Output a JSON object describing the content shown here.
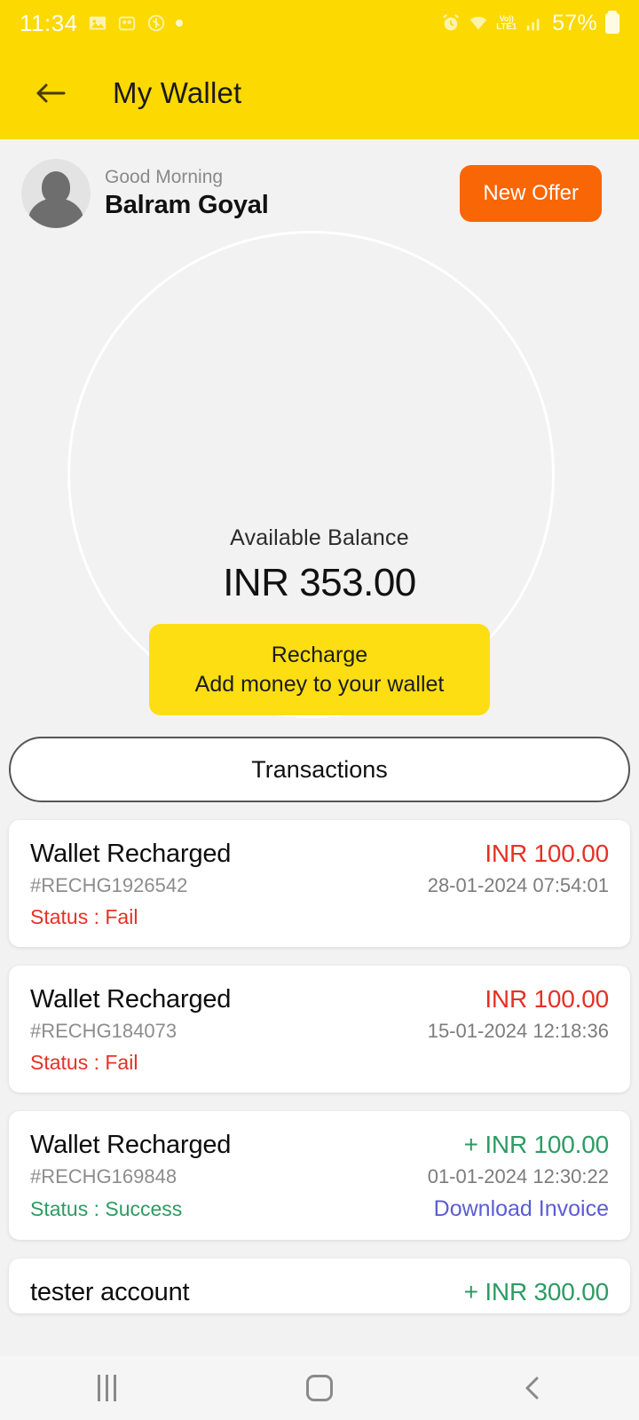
{
  "status_bar": {
    "time": "11:34",
    "battery_percent": "57%",
    "network_label_top": "Vo))",
    "network_label_bottom": "LTE1",
    "icons": [
      "image-icon",
      "app-icon",
      "app-icon-2",
      "dot-indicator",
      "alarm-icon",
      "wifi-icon",
      "volte-icon",
      "signal-icon",
      "battery-icon"
    ]
  },
  "header": {
    "title": "My Wallet",
    "back_icon": "arrow-left-icon"
  },
  "profile": {
    "greeting": "Good Morning",
    "name": "Balram Goyal",
    "offer_button": "New Offer"
  },
  "balance": {
    "label": "Available Balance",
    "amount": "INR 353.00",
    "recharge_line1": "Recharge",
    "recharge_line2": "Add money to your wallet"
  },
  "transactions_tab": {
    "label": "Transactions"
  },
  "transactions": [
    {
      "title": "Wallet Recharged",
      "reference": "#RECHG1926542",
      "status": "Status : Fail",
      "status_type": "fail",
      "amount": "INR 100.00",
      "amount_type": "fail",
      "datetime": "28-01-2024 07:54:01",
      "invoice": ""
    },
    {
      "title": "Wallet Recharged",
      "reference": "#RECHG184073",
      "status": "Status : Fail",
      "status_type": "fail",
      "amount": "INR 100.00",
      "amount_type": "fail",
      "datetime": "15-01-2024 12:18:36",
      "invoice": ""
    },
    {
      "title": "Wallet Recharged",
      "reference": "#RECHG169848",
      "status": "Status : Success",
      "status_type": "success",
      "amount": "+ INR 100.00",
      "amount_type": "success",
      "datetime": "01-01-2024 12:30:22",
      "invoice": "Download Invoice"
    }
  ],
  "transaction_partial": {
    "title": "tester account",
    "amount": "+ INR 300.00",
    "amount_type": "success"
  },
  "nav_bar": {
    "recents": "recents-icon",
    "home": "home-icon",
    "back": "back-icon"
  },
  "colors": {
    "brand_yellow": "#FCD900",
    "recharge_yellow": "#FCDE13",
    "offer_orange": "#F96606",
    "fail_red": "#E53127",
    "success_green": "#2E9B63",
    "invoice_purple": "#5C5CD6",
    "page_bg": "#F2F2F2"
  }
}
